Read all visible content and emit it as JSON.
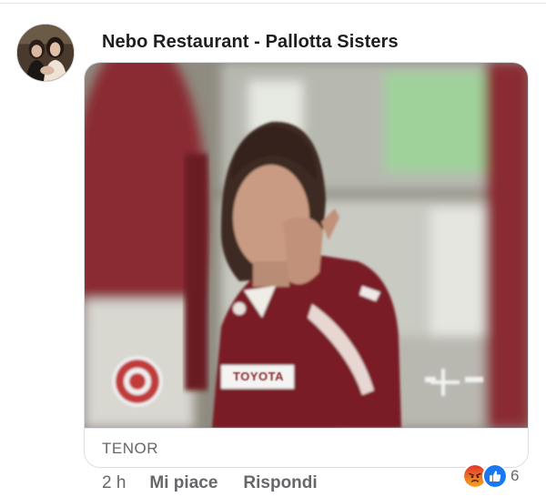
{
  "comment": {
    "author": "Nebo Restaurant - Pallotta Sisters",
    "avatar_icon": "profile-photo-avatar",
    "gif": {
      "source_label": "TENOR",
      "jersey_text": "TOYOTA"
    },
    "timestamp": "2 h",
    "actions": {
      "like_label": "Mi piace",
      "reply_label": "Rispondi"
    },
    "reactions": {
      "icons": [
        "angry-reaction-icon",
        "like-reaction-icon"
      ],
      "count": "6"
    }
  },
  "colors": {
    "secondary_text": "#65676b",
    "like_blue": "#1877f2",
    "angry_orange": "#e9710f",
    "jersey_maroon": "#7a1f28"
  }
}
